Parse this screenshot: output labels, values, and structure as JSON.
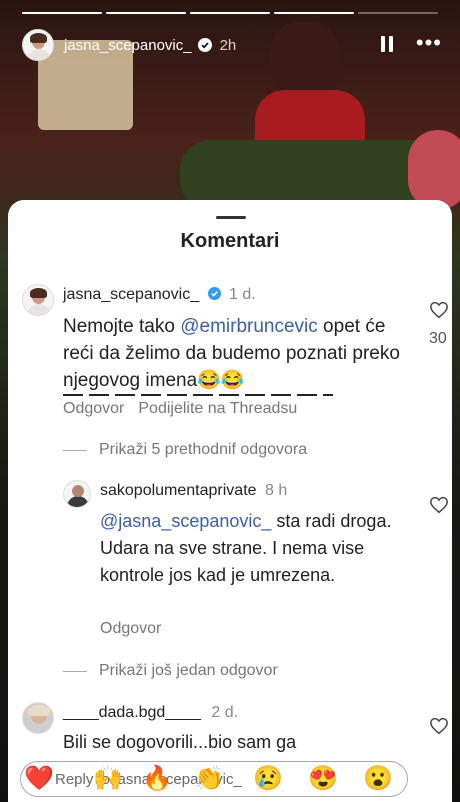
{
  "story": {
    "username": "jasna_scepanovic_",
    "time": "2h",
    "progress_total": 5,
    "progress_done": 4
  },
  "sheet": {
    "title": "Komentari"
  },
  "comments": [
    {
      "username": "jasna_scepanovic_",
      "time": "1 d.",
      "text_pre": "Nemojte tako ",
      "mention": "@emirbruncevic",
      "text_post": " opet će reći da želimo da budemo poznati preko njegovog imena😂😂",
      "likes": "30",
      "reply_label": "Odgovor",
      "share_label": "Podijelite na Threadsu",
      "replies_toggle": "Prikaži 5 prethodnif odgovora"
    },
    {
      "username": "sakopolumentaprivate",
      "time": "8 h",
      "mention": "@jasna_scepanovic_",
      "text_post": " sta radi droga. Udara na sve strane. I nema vise kontrole jos kad je umrezena.",
      "reply_label": "Odgovor",
      "replies_toggle": "Prikaži još jedan odgovor"
    },
    {
      "username": "____dada.bgd____",
      "time": "2 d.",
      "text": "Bili se dogovorili...bio sam ga"
    }
  ],
  "reply_bar": {
    "placeholder": "Reply to jasna_scepanovic_",
    "emojis": [
      "❤️",
      "🙌",
      "🔥",
      "👏",
      "😢",
      "😍",
      "😮"
    ]
  },
  "colors": {
    "mention": "#3b5ea8",
    "verified": "#3897f0"
  }
}
